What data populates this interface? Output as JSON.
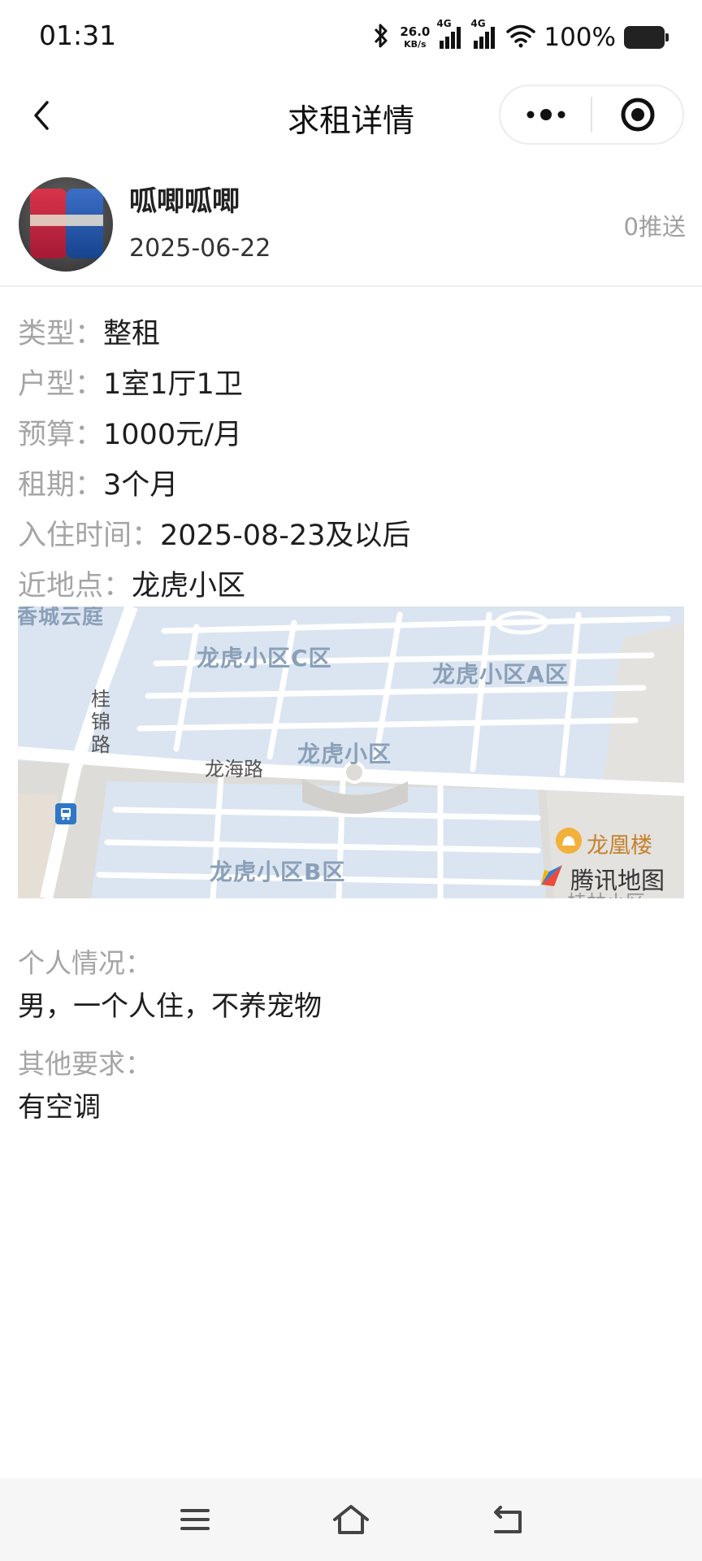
{
  "status_bar": {
    "time": "01:31",
    "net_speed_value": "26.0",
    "net_speed_unit": "KB/s",
    "signal1_label": "4G",
    "signal2_label": "4G",
    "battery_percent": "100%"
  },
  "nav": {
    "title": "求租详情"
  },
  "user": {
    "name": "呱唧呱唧",
    "date": "2025-06-22",
    "push_count": "0推送"
  },
  "details": [
    {
      "label": "类型：",
      "value": "整租"
    },
    {
      "label": "户型：",
      "value": "1室1厅1卫"
    },
    {
      "label": "预算：",
      "value": "1000元/月"
    },
    {
      "label": "租期：",
      "value": "3个月"
    },
    {
      "label": "入住时间：",
      "value": "2025-08-23及以后"
    },
    {
      "label": "近地点：",
      "value": "龙虎小区"
    }
  ],
  "map": {
    "labels": {
      "area_c": "龙虎小区C区",
      "area_a": "龙虎小区A区",
      "area_main": "龙虎小区",
      "area_b": "龙虎小区B区",
      "top_left": "香城云庭"
    },
    "roads": {
      "guijin": "桂锦路",
      "longhai": "龙海路"
    },
    "poi": "龙凰楼",
    "poi_partial": "桂林小区",
    "watermark": "腾讯地图"
  },
  "personal": {
    "label": "个人情况：",
    "value": "男，一个人住，不养宠物"
  },
  "other": {
    "label": "其他要求：",
    "value": "有空调"
  },
  "colors": {
    "map_block": "#dbe5f1",
    "map_road": "#ffffff",
    "map_bg": "#dddcd9",
    "poi_accent": "#f2b13a",
    "label_gray": "#a5a5a5"
  }
}
